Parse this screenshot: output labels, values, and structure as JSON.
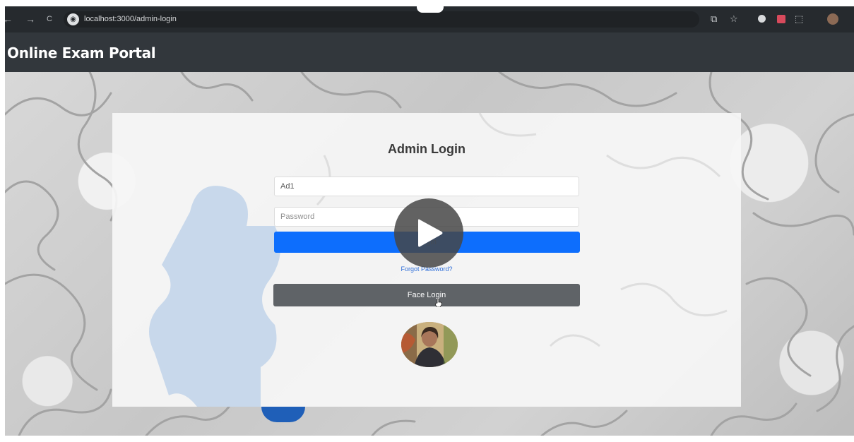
{
  "browser": {
    "url": "localhost:3000/admin-login",
    "back_glyph": "←",
    "forward_glyph": "→",
    "reload_glyph": "C",
    "site_glyph": "◉",
    "cast_glyph": "⧉",
    "star_glyph": "☆",
    "extensions_glyph": "⬚"
  },
  "app": {
    "brand": "Online Exam Portal"
  },
  "login": {
    "title": "Admin Login",
    "username_value": "Ad1",
    "password_placeholder": "Password",
    "login_label": "Login",
    "forgot_label": "Forgot Password?",
    "face_login_label": "Face Login"
  },
  "colors": {
    "primary": "#0d6efd",
    "secondary": "#5f6367",
    "navbar": "#32373c"
  }
}
